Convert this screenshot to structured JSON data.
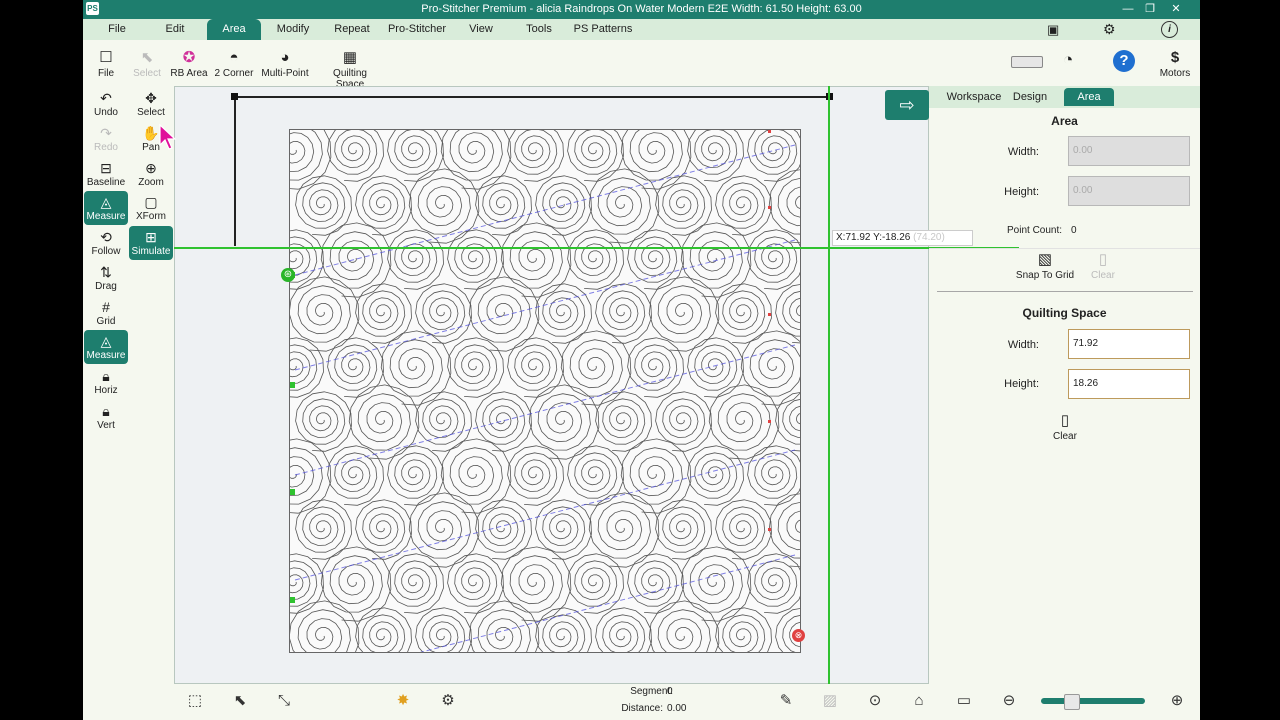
{
  "window": {
    "logo": "PS",
    "title": "Pro-Stitcher Premium  -  alicia  Raindrops On Water Modern E2E  Width: 61.50   Height: 63.00",
    "controls": [
      "—",
      "❐",
      "✕"
    ]
  },
  "menu": [
    {
      "label": "File"
    },
    {
      "label": "Edit"
    },
    {
      "label": "Area"
    },
    {
      "label": "Modify"
    },
    {
      "label": "Repeat"
    },
    {
      "label": "Pro-Stitcher"
    },
    {
      "label": "View"
    },
    {
      "label": "Tools"
    },
    {
      "label": "PS Patterns"
    }
  ],
  "ribbon": {
    "file": "File",
    "select": "Select",
    "rb_area": "RB Area",
    "two_corner": "2 Corner",
    "multi_point": "Multi-Point",
    "quilting_space": "Quilting Space",
    "motors": "Motors",
    "motors_symbol": "$"
  },
  "left_tools": {
    "undo": "Undo",
    "select": "Select",
    "redo": "Redo",
    "pan": "Pan",
    "baseline": "Baseline",
    "zoom": "Zoom",
    "measure": "Measure",
    "xform": "XForm",
    "follow": "Follow",
    "simulate": "Simulate",
    "drag": "Drag",
    "grid": "Grid",
    "measure2": "Measure",
    "horiz": "Horiz",
    "vert": "Vert"
  },
  "canvas": {
    "coordinate": "X:71.92  Y:-18.26",
    "coordinate_ghost": "(74.20)"
  },
  "panel": {
    "tabs": [
      "Workspace",
      "Design",
      "Area"
    ],
    "area_title": "Area",
    "width_label": "Width:",
    "width_value": "0.00",
    "height_label": "Height:",
    "height_value": "0.00",
    "point_count_label": "Point Count:",
    "point_count": "0",
    "snap_to_grid": "Snap To Grid",
    "clear_disabled": "Clear",
    "qs_title": "Quilting Space",
    "qs_width_label": "Width:",
    "qs_width": "71.92",
    "qs_height_label": "Height:",
    "qs_height": "18.26",
    "clear": "Clear"
  },
  "status": {
    "segment_label": "Segment:",
    "segment": "0",
    "distance_label": "Distance:",
    "distance": "0.00",
    "zoom_level": 0.25
  },
  "colors": {
    "accent": "#1e7e6e",
    "menubar": "#d9ecda",
    "guide_line": "#2fc22f",
    "start_marker": "#29b529",
    "end_marker": "#e04040",
    "path_line": "#5555dd"
  }
}
